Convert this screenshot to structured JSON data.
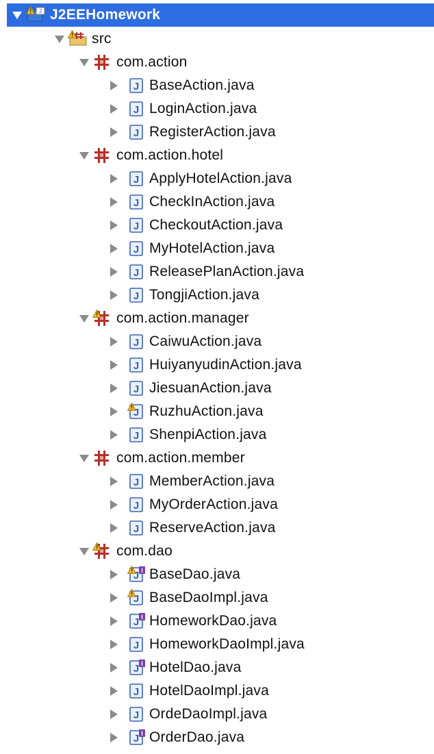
{
  "project": {
    "name": "J2EEHomework",
    "selected": true,
    "warning": true
  },
  "source_folder": {
    "name": "src",
    "warning": true
  },
  "packages": [
    {
      "name": "com.action",
      "warning": false,
      "files": [
        {
          "name": "BaseAction.java",
          "kind": "class",
          "warning": false
        },
        {
          "name": "LoginAction.java",
          "kind": "class",
          "warning": false
        },
        {
          "name": "RegisterAction.java",
          "kind": "class",
          "warning": false
        }
      ]
    },
    {
      "name": "com.action.hotel",
      "warning": false,
      "files": [
        {
          "name": "ApplyHotelAction.java",
          "kind": "class",
          "warning": false
        },
        {
          "name": "CheckInAction.java",
          "kind": "class",
          "warning": false
        },
        {
          "name": "CheckoutAction.java",
          "kind": "class",
          "warning": false
        },
        {
          "name": "MyHotelAction.java",
          "kind": "class",
          "warning": false
        },
        {
          "name": "ReleasePlanAction.java",
          "kind": "class",
          "warning": false
        },
        {
          "name": "TongjiAction.java",
          "kind": "class",
          "warning": false
        }
      ]
    },
    {
      "name": "com.action.manager",
      "warning": true,
      "files": [
        {
          "name": "CaiwuAction.java",
          "kind": "class",
          "warning": false
        },
        {
          "name": "HuiyanyudinAction.java",
          "kind": "class",
          "warning": false
        },
        {
          "name": "JiesuanAction.java",
          "kind": "class",
          "warning": false
        },
        {
          "name": "RuzhuAction.java",
          "kind": "class",
          "warning": true
        },
        {
          "name": "ShenpiAction.java",
          "kind": "class",
          "warning": false
        }
      ]
    },
    {
      "name": "com.action.member",
      "warning": false,
      "files": [
        {
          "name": "MemberAction.java",
          "kind": "class",
          "warning": false
        },
        {
          "name": "MyOrderAction.java",
          "kind": "class",
          "warning": false
        },
        {
          "name": "ReserveAction.java",
          "kind": "class",
          "warning": false
        }
      ]
    },
    {
      "name": "com.dao",
      "warning": true,
      "files": [
        {
          "name": "BaseDao.java",
          "kind": "interface",
          "warning": true
        },
        {
          "name": "BaseDaoImpl.java",
          "kind": "class",
          "warning": true
        },
        {
          "name": "HomeworkDao.java",
          "kind": "interface",
          "warning": false
        },
        {
          "name": "HomeworkDaoImpl.java",
          "kind": "class",
          "warning": false
        },
        {
          "name": "HotelDao.java",
          "kind": "interface",
          "warning": false
        },
        {
          "name": "HotelDaoImpl.java",
          "kind": "class",
          "warning": false
        },
        {
          "name": "OrdeDaoImpl.java",
          "kind": "class",
          "warning": false
        },
        {
          "name": "OrderDao.java",
          "kind": "interface",
          "warning": false
        }
      ]
    }
  ],
  "colors": {
    "selection": "#2d6de2",
    "arrow": "#8a8a8a",
    "package": "#b5302a",
    "java_icon_border": "#3a62b3",
    "java_icon_fill": "#eaf1fb",
    "interface_badge": "#7b3fa6",
    "warning": "#f2b824"
  },
  "icons": {
    "expanded": "triangle-down-icon",
    "collapsed": "triangle-right-icon",
    "project": "java-project-icon",
    "source_folder": "source-folder-icon",
    "package": "package-icon",
    "class_file": "java-class-file-icon",
    "interface_file": "java-interface-file-icon",
    "warning_overlay": "warning-overlay-icon"
  }
}
